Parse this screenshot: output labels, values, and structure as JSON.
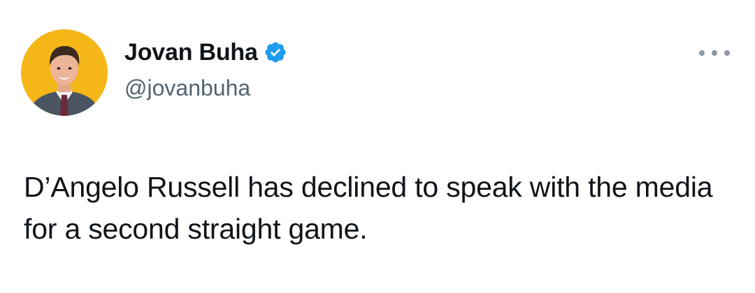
{
  "tweet": {
    "author": {
      "display_name": "Jovan Buha",
      "handle": "@jovanbuha",
      "verified": true,
      "avatar_icon": "profile-photo"
    },
    "text": "D’Angelo Russell has declined to speak with the media for a second straight game.",
    "more_icon": "ellipsis-icon"
  },
  "colors": {
    "avatar_background": "#f5b718",
    "verified_badge": "#1d9bf0",
    "handle_text": "#536471",
    "primary_text": "#0f1419",
    "more_dots": "#8b98a5"
  }
}
